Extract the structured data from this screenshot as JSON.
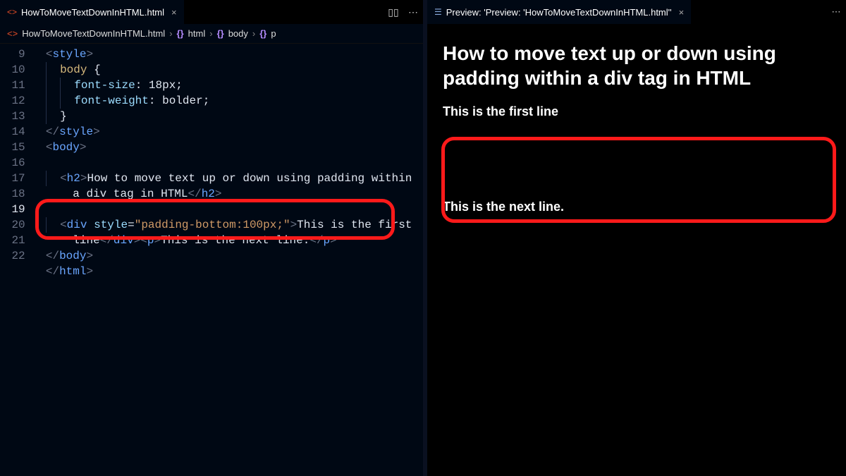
{
  "editor": {
    "tab": {
      "filename": "HowToMoveTextDownInHTML.html",
      "close": "×"
    },
    "actions": {
      "split": "▯▯",
      "more": "⋯"
    },
    "breadcrumbs": {
      "file": "HowToMoveTextDownInHTML.html",
      "sep": "›",
      "crumb1": "html",
      "crumb2": "body",
      "crumb3": "p"
    },
    "lines": {
      "n9": "9",
      "n10": "10",
      "n11": "11",
      "n12": "12",
      "n13": "13",
      "n14": "14",
      "n15": "15",
      "n16": "16",
      "n17": "17",
      "n18": "18",
      "n19": "19",
      "n20": "20",
      "n21": "21",
      "n22": "22"
    },
    "code": {
      "l9a": "<",
      "l9b": "style",
      "l9c": ">",
      "l10a": "body",
      "l10b": " {",
      "l11a": "font-size",
      "l11b": ": ",
      "l11c": "18px",
      "l11d": ";",
      "l12a": "font-weight",
      "l12b": ": ",
      "l12c": "bolder",
      "l12d": ";",
      "l13a": "}",
      "l14a": "</",
      "l14b": "style",
      "l14c": ">",
      "l15a": "<",
      "l15b": "body",
      "l15c": ">",
      "l17a": "<",
      "l17b": "h2",
      "l17c": ">",
      "l17d": "How to move text up or down using padding within ",
      "l17e": "a div tag in HTML",
      "l17f": "</",
      "l17g": "h2",
      "l17h": ">",
      "l19a": "<",
      "l19b": "div",
      "l19c": " ",
      "l19d": "style",
      "l19e": "=",
      "l19f": "\"padding-bottom:100px;\"",
      "l19g": ">",
      "l19h": "This is the first ",
      "l19i": "line",
      "l19j": "</",
      "l19k": "div",
      "l19l": "><",
      "l19m": "p",
      "l19n": ">",
      "l19o": "This is the next line.",
      "l19p": "</",
      "l19q": "p",
      "l19r": ">",
      "l21a": "</",
      "l21b": "body",
      "l21c": ">",
      "l22a": "</",
      "l22b": "html",
      "l22c": ">"
    }
  },
  "preview": {
    "tab": {
      "label": "Preview: 'Preview: 'HowToMoveTextDownInHTML.html''",
      "close": "×"
    },
    "more": "⋯",
    "heading": "How to move text up or down using padding within a div tag in HTML",
    "firstline": "This is the first line",
    "nextline": "This is the next line."
  }
}
